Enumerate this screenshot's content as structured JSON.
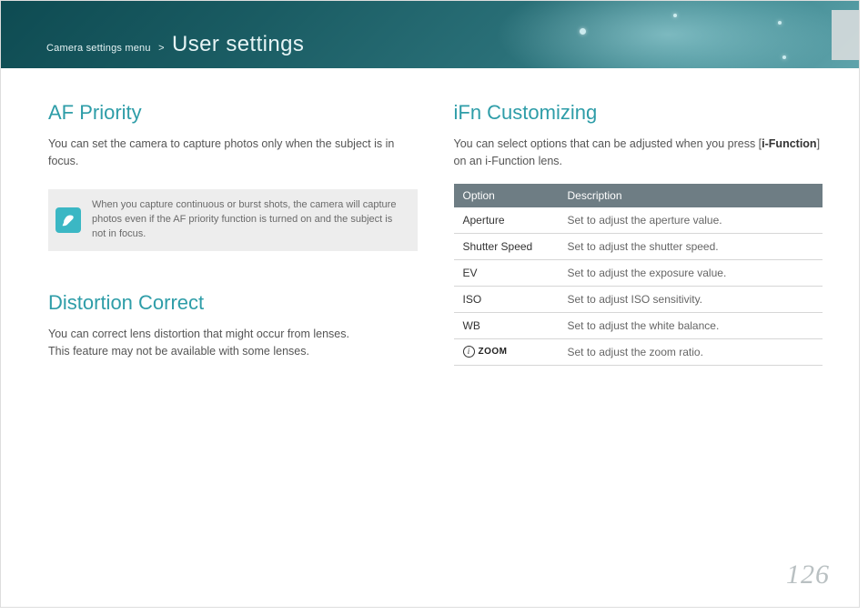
{
  "breadcrumb": {
    "parent": "Camera settings menu",
    "separator": ">",
    "current": "User settings"
  },
  "page_number": "126",
  "left_column": {
    "af_priority": {
      "title": "AF Priority",
      "body": "You can set the camera to capture photos only when the subject is in focus.",
      "note": "When you capture continuous or burst shots, the camera will capture photos even if the AF priority function is turned on and the subject is not in focus."
    },
    "distortion_correct": {
      "title": "Distortion Correct",
      "body_line1": "You can correct lens distortion that might occur from lenses.",
      "body_line2": "This feature may not be available with some lenses."
    }
  },
  "right_column": {
    "ifn": {
      "title": "iFn Customizing",
      "intro_pre": "You can select options that can be adjusted when you press [",
      "intro_bold": "i-Function",
      "intro_post": "] on an i-Function lens.",
      "table": {
        "header_option": "Option",
        "header_description": "Description",
        "rows": [
          {
            "option": "Aperture",
            "description": "Set to adjust the aperture value."
          },
          {
            "option": "Shutter Speed",
            "description": "Set to adjust the shutter speed."
          },
          {
            "option": "EV",
            "description": "Set to adjust the exposure value."
          },
          {
            "option": "ISO",
            "description": "Set to adjust ISO sensitivity."
          },
          {
            "option": "WB",
            "description": "Set to adjust the white balance."
          },
          {
            "option_icon": "i-zoom",
            "zoom_label": "ZOOM",
            "description": "Set to adjust the zoom ratio."
          }
        ]
      }
    }
  },
  "icons": {
    "pen_note": "pen-icon",
    "circled_i": "i"
  }
}
